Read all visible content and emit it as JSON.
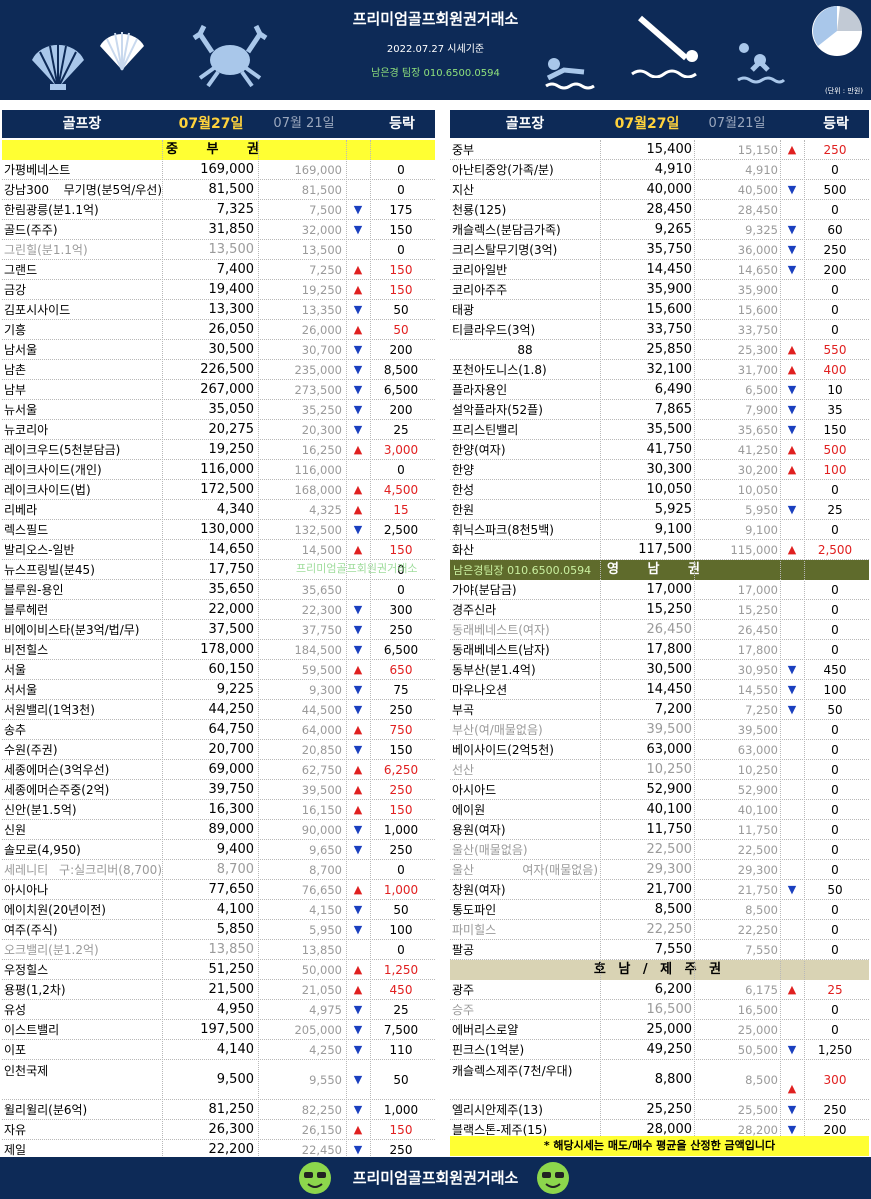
{
  "header": {
    "title": "프리미엄골프회원권거래소",
    "date": "2022.07.27 시세기준",
    "contact": "남은경 팀장 010.6500.0594",
    "unit": "(단위 : 만원)"
  },
  "columns": {
    "name": "골프장",
    "date1": "07월27일",
    "date2_left": "07월 21일",
    "date2_right": "07월21일",
    "change": "등락"
  },
  "left": {
    "section": "중 부 권",
    "rows": [
      {
        "name": "가평베네스트",
        "p1": "169,000",
        "p2": "169,000",
        "dir": "",
        "ch": "0",
        "grey": false
      },
      {
        "name": "강남300 무기명(분5억/우선)",
        "p1": "81,500",
        "p2": "81,500",
        "dir": "",
        "ch": "0",
        "grey": false
      },
      {
        "name": "한림광릉(분1.1억)",
        "p1": "7,325",
        "p2": "7,500",
        "dir": "down",
        "ch": "175",
        "grey": false
      },
      {
        "name": "골드(주주)",
        "p1": "31,850",
        "p2": "32,000",
        "dir": "down",
        "ch": "150",
        "grey": false
      },
      {
        "name": "그린힐(분1.1억)",
        "p1": "13,500",
        "p2": "13,500",
        "dir": "",
        "ch": "0",
        "grey": true
      },
      {
        "name": "그랜드",
        "p1": "7,400",
        "p2": "7,250",
        "dir": "up",
        "ch": "150",
        "grey": false
      },
      {
        "name": "금강",
        "p1": "19,400",
        "p2": "19,250",
        "dir": "up",
        "ch": "150",
        "grey": false
      },
      {
        "name": "김포시사이드",
        "p1": "13,300",
        "p2": "13,350",
        "dir": "down",
        "ch": "50",
        "grey": false
      },
      {
        "name": "기흥",
        "p1": "26,050",
        "p2": "26,000",
        "dir": "up",
        "ch": "50",
        "grey": false
      },
      {
        "name": "남서울",
        "p1": "30,500",
        "p2": "30,700",
        "dir": "down",
        "ch": "200",
        "grey": false
      },
      {
        "name": "남촌",
        "p1": "226,500",
        "p2": "235,000",
        "dir": "down",
        "ch": "8,500",
        "grey": false
      },
      {
        "name": "남부",
        "p1": "267,000",
        "p2": "273,500",
        "dir": "down",
        "ch": "6,500",
        "grey": false
      },
      {
        "name": "뉴서울",
        "p1": "35,050",
        "p2": "35,250",
        "dir": "down",
        "ch": "200",
        "grey": false
      },
      {
        "name": "뉴코리아",
        "p1": "20,275",
        "p2": "20,300",
        "dir": "down",
        "ch": "25",
        "grey": false
      },
      {
        "name": "레이크우드(5천분담금)",
        "p1": "19,250",
        "p2": "16,250",
        "dir": "up",
        "ch": "3,000",
        "grey": false
      },
      {
        "name": "레이크사이드(개인)",
        "p1": "116,000",
        "p2": "116,000",
        "dir": "",
        "ch": "0",
        "grey": false
      },
      {
        "name": "레이크사이드(법)",
        "p1": "172,500",
        "p2": "168,000",
        "dir": "up",
        "ch": "4,500",
        "grey": false
      },
      {
        "name": "리베라",
        "p1": "4,340",
        "p2": "4,325",
        "dir": "up",
        "ch": "15",
        "grey": false
      },
      {
        "name": "렉스필드",
        "p1": "130,000",
        "p2": "132,500",
        "dir": "down",
        "ch": "2,500",
        "grey": false
      },
      {
        "name": "발리오스-일반",
        "p1": "14,650",
        "p2": "14,500",
        "dir": "up",
        "ch": "150",
        "grey": false
      },
      {
        "name": "뉴스프링빌(분45)",
        "p1": "17,750",
        "p2": "",
        "dir": "",
        "ch": "0",
        "grey": false
      },
      {
        "name": "블루원-용인",
        "p1": "35,650",
        "p2": "35,650",
        "dir": "",
        "ch": "0",
        "grey": false
      },
      {
        "name": "블루헤런",
        "p1": "22,000",
        "p2": "22,300",
        "dir": "down",
        "ch": "300",
        "grey": false
      },
      {
        "name": "비에이비스타(분3억/법/무)",
        "p1": "37,500",
        "p2": "37,750",
        "dir": "down",
        "ch": "250",
        "grey": false
      },
      {
        "name": "비전힐스",
        "p1": "178,000",
        "p2": "184,500",
        "dir": "down",
        "ch": "6,500",
        "grey": false
      },
      {
        "name": "서울",
        "p1": "60,150",
        "p2": "59,500",
        "dir": "up",
        "ch": "650",
        "grey": false
      },
      {
        "name": "서서울",
        "p1": "9,225",
        "p2": "9,300",
        "dir": "down",
        "ch": "75",
        "grey": false
      },
      {
        "name": "서원밸리(1억3천)",
        "p1": "44,250",
        "p2": "44,500",
        "dir": "down",
        "ch": "250",
        "grey": false
      },
      {
        "name": "송추",
        "p1": "64,750",
        "p2": "64,000",
        "dir": "up",
        "ch": "750",
        "grey": false
      },
      {
        "name": "수원(주권)",
        "p1": "20,700",
        "p2": "20,850",
        "dir": "down",
        "ch": "150",
        "grey": false
      },
      {
        "name": "세종에머슨(3억우선)",
        "p1": "69,000",
        "p2": "62,750",
        "dir": "up",
        "ch": "6,250",
        "grey": false
      },
      {
        "name": "세종에머슨주중(2억)",
        "p1": "39,750",
        "p2": "39,500",
        "dir": "up",
        "ch": "250",
        "grey": false
      },
      {
        "name": "신안(분1.5억)",
        "p1": "16,300",
        "p2": "16,150",
        "dir": "up",
        "ch": "150",
        "grey": false
      },
      {
        "name": "신원",
        "p1": "89,000",
        "p2": "90,000",
        "dir": "down",
        "ch": "1,000",
        "grey": false
      },
      {
        "name": "솔모로(4,950)",
        "p1": "9,400",
        "p2": "9,650",
        "dir": "down",
        "ch": "250",
        "grey": false
      },
      {
        "name": "세레니티 구:실크리버(8,700)",
        "p1": "8,700",
        "p2": "8,700",
        "dir": "",
        "ch": "0",
        "grey": true
      },
      {
        "name": "아시아나",
        "p1": "77,650",
        "p2": "76,650",
        "dir": "up",
        "ch": "1,000",
        "grey": false
      },
      {
        "name": "에이치원(20년이전)",
        "p1": "4,100",
        "p2": "4,150",
        "dir": "down",
        "ch": "50",
        "grey": false
      },
      {
        "name": "여주(주식)",
        "p1": "5,850",
        "p2": "5,950",
        "dir": "down",
        "ch": "100",
        "grey": false
      },
      {
        "name": "오크밸리(분1.2억)",
        "p1": "13,850",
        "p2": "13,850",
        "dir": "",
        "ch": "0",
        "grey": true
      },
      {
        "name": "우정힐스",
        "p1": "51,250",
        "p2": "50,000",
        "dir": "up",
        "ch": "1,250",
        "grey": false
      },
      {
        "name": "용평(1,2차)",
        "p1": "21,500",
        "p2": "21,050",
        "dir": "up",
        "ch": "450",
        "grey": false
      },
      {
        "name": "유성",
        "p1": "4,950",
        "p2": "4,975",
        "dir": "down",
        "ch": "25",
        "grey": false
      },
      {
        "name": "이스트밸리",
        "p1": "197,500",
        "p2": "205,000",
        "dir": "down",
        "ch": "7,500",
        "grey": false
      },
      {
        "name": "이포",
        "p1": "4,140",
        "p2": "4,250",
        "dir": "down",
        "ch": "110",
        "grey": false
      },
      {
        "name": "인천국제",
        "p1": "9,500",
        "p2": "9,550",
        "dir": "down",
        "ch": "50",
        "grey": false,
        "tall": true
      },
      {
        "name": "윌리윌리(분6억)",
        "p1": "81,250",
        "p2": "82,250",
        "dir": "down",
        "ch": "1,000",
        "grey": false
      },
      {
        "name": "자유",
        "p1": "26,300",
        "p2": "26,150",
        "dir": "up",
        "ch": "150",
        "grey": false
      },
      {
        "name": "제일",
        "p1": "22,200",
        "p2": "22,450",
        "dir": "down",
        "ch": "250",
        "grey": false
      }
    ]
  },
  "right": {
    "rows_a": [
      {
        "name": "중부",
        "p1": "15,400",
        "p2": "15,150",
        "dir": "up",
        "ch": "250",
        "grey": false
      },
      {
        "name": "아난티중앙(가족/분)",
        "p1": "4,910",
        "p2": "4,910",
        "dir": "",
        "ch": "0",
        "grey": false
      },
      {
        "name": "지산",
        "p1": "40,000",
        "p2": "40,500",
        "dir": "down",
        "ch": "500",
        "grey": false
      },
      {
        "name": "천룡(125)",
        "p1": "28,450",
        "p2": "28,450",
        "dir": "",
        "ch": "0",
        "grey": false
      },
      {
        "name": "캐슬렉스(분담금가족)",
        "p1": "9,265",
        "p2": "9,325",
        "dir": "down",
        "ch": "60",
        "grey": false
      },
      {
        "name": "크리스탈무기명(3억)",
        "p1": "35,750",
        "p2": "36,000",
        "dir": "down",
        "ch": "250",
        "grey": false
      },
      {
        "name": "코리아일반",
        "p1": "14,450",
        "p2": "14,650",
        "dir": "down",
        "ch": "200",
        "grey": false
      },
      {
        "name": "코리아주주",
        "p1": "35,900",
        "p2": "35,900",
        "dir": "",
        "ch": "0",
        "grey": false
      },
      {
        "name": "태광",
        "p1": "15,600",
        "p2": "15,600",
        "dir": "",
        "ch": "0",
        "grey": false
      },
      {
        "name": "티클라우드(3억)",
        "p1": "33,750",
        "p2": "33,750",
        "dir": "",
        "ch": "0",
        "grey": false
      },
      {
        "name": "88",
        "p1": "25,850",
        "p2": "25,300",
        "dir": "up",
        "ch": "550",
        "grey": false,
        "center": true
      },
      {
        "name": "포천아도니스(1.8)",
        "p1": "32,100",
        "p2": "31,700",
        "dir": "up",
        "ch": "400",
        "grey": false
      },
      {
        "name": "플라자용인",
        "p1": "6,490",
        "p2": "6,500",
        "dir": "down",
        "ch": "10",
        "grey": false
      },
      {
        "name": "설악플라자(52플)",
        "p1": "7,865",
        "p2": "7,900",
        "dir": "down",
        "ch": "35",
        "grey": false
      },
      {
        "name": "프리스틴밸리",
        "p1": "35,500",
        "p2": "35,650",
        "dir": "down",
        "ch": "150",
        "grey": false
      },
      {
        "name": "한양(여자)",
        "p1": "41,750",
        "p2": "41,250",
        "dir": "up",
        "ch": "500",
        "grey": false
      },
      {
        "name": "한양",
        "p1": "30,300",
        "p2": "30,200",
        "dir": "up",
        "ch": "100",
        "grey": false
      },
      {
        "name": "한성",
        "p1": "10,050",
        "p2": "10,050",
        "dir": "",
        "ch": "0",
        "grey": false
      },
      {
        "name": "한원",
        "p1": "5,925",
        "p2": "5,950",
        "dir": "down",
        "ch": "25",
        "grey": false
      },
      {
        "name": "휘닉스파크(8천5백)",
        "p1": "9,100",
        "p2": "9,100",
        "dir": "",
        "ch": "0",
        "grey": false
      },
      {
        "name": "화산",
        "p1": "117,500",
        "p2": "115,000",
        "dir": "up",
        "ch": "2,500",
        "grey": false
      }
    ],
    "section_b": "영 남 권",
    "section_b_contact": "남은경팀장 010.6500.0594",
    "rows_b": [
      {
        "name": "가야(분담금)",
        "p1": "17,000",
        "p2": "17,000",
        "dir": "",
        "ch": "0",
        "grey": false
      },
      {
        "name": "경주신라",
        "p1": "15,250",
        "p2": "15,250",
        "dir": "",
        "ch": "0",
        "grey": false
      },
      {
        "name": "동래베네스트(여자)",
        "p1": "26,450",
        "p2": "26,450",
        "dir": "",
        "ch": "0",
        "grey": true
      },
      {
        "name": "동래베네스트(남자)",
        "p1": "17,800",
        "p2": "17,800",
        "dir": "",
        "ch": "0",
        "grey": false
      },
      {
        "name": "동부산(분1.4억)",
        "p1": "30,500",
        "p2": "30,950",
        "dir": "down",
        "ch": "450",
        "grey": false
      },
      {
        "name": "마우나오션",
        "p1": "14,450",
        "p2": "14,550",
        "dir": "down",
        "ch": "100",
        "grey": false
      },
      {
        "name": "부곡",
        "p1": "7,200",
        "p2": "7,250",
        "dir": "down",
        "ch": "50",
        "grey": false
      },
      {
        "name": "부산(여/매물없음)",
        "p1": "39,500",
        "p2": "39,500",
        "dir": "",
        "ch": "0",
        "grey": true
      },
      {
        "name": "베이사이드(2억5천)",
        "p1": "63,000",
        "p2": "63,000",
        "dir": "",
        "ch": "0",
        "grey": false
      },
      {
        "name": "선산",
        "p1": "10,250",
        "p2": "10,250",
        "dir": "",
        "ch": "0",
        "grey": true
      },
      {
        "name": "아시아드",
        "p1": "52,900",
        "p2": "52,900",
        "dir": "",
        "ch": "0",
        "grey": false
      },
      {
        "name": "에이원",
        "p1": "40,100",
        "p2": "40,100",
        "dir": "",
        "ch": "0",
        "grey": false
      },
      {
        "name": "용원(여자)",
        "p1": "11,750",
        "p2": "11,750",
        "dir": "",
        "ch": "0",
        "grey": false
      },
      {
        "name": "울산(매물없음)",
        "p1": "22,500",
        "p2": "22,500",
        "dir": "",
        "ch": "0",
        "grey": true
      },
      {
        "name": "울산 여자(매물없음)",
        "p1": "29,300",
        "p2": "29,300",
        "dir": "",
        "ch": "0",
        "grey": true
      },
      {
        "name": "창원(여자)",
        "p1": "21,700",
        "p2": "21,750",
        "dir": "down",
        "ch": "50",
        "grey": false
      },
      {
        "name": "통도파인",
        "p1": "8,500",
        "p2": "8,500",
        "dir": "",
        "ch": "0",
        "grey": false
      },
      {
        "name": "파미힐스",
        "p1": "22,250",
        "p2": "22,250",
        "dir": "",
        "ch": "0",
        "grey": true
      },
      {
        "name": "팔공",
        "p1": "7,550",
        "p2": "7,550",
        "dir": "",
        "ch": "0",
        "grey": false
      }
    ],
    "section_c": "호 남 / 제 주 권",
    "rows_c": [
      {
        "name": "광주",
        "p1": "6,200",
        "p2": "6,175",
        "dir": "up",
        "ch": "25",
        "grey": false
      },
      {
        "name": "승주",
        "p1": "16,500",
        "p2": "16,500",
        "dir": "",
        "ch": "0",
        "grey": true
      },
      {
        "name": "에버리스로얄",
        "p1": "25,000",
        "p2": "25,000",
        "dir": "",
        "ch": "0",
        "grey": false
      },
      {
        "name": "핀크스(1억분)",
        "p1": "49,250",
        "p2": "50,500",
        "dir": "down",
        "ch": "1,250",
        "grey": false
      },
      {
        "name": "캐슬렉스제주(7천/우대)",
        "p1": "8,800",
        "p2": "8,500",
        "dir": "up",
        "ch": "300",
        "grey": false,
        "tall": true
      },
      {
        "name": "엘리시안제주(13)",
        "p1": "25,250",
        "p2": "25,500",
        "dir": "down",
        "ch": "250",
        "grey": false
      },
      {
        "name": "블랙스톤-제주(15)",
        "p1": "28,000",
        "p2": "28,200",
        "dir": "down",
        "ch": "200",
        "grey": false
      }
    ]
  },
  "watermark": "프리미엄골프회원권거래소",
  "note": "* 해당시세는 매도/매수 평균을 산정한 금액입니다",
  "footer": {
    "title": "프리미엄골프회원권거래소"
  },
  "icons": {
    "up": "▲",
    "down": "▼"
  },
  "colors": {
    "navy": "#0d2a57",
    "yellow": "#ffff33",
    "up": "#e02020",
    "down": "#1a3fbf",
    "section_yn": "#5f6b2c",
    "section_hn": "#d9d3b4"
  }
}
